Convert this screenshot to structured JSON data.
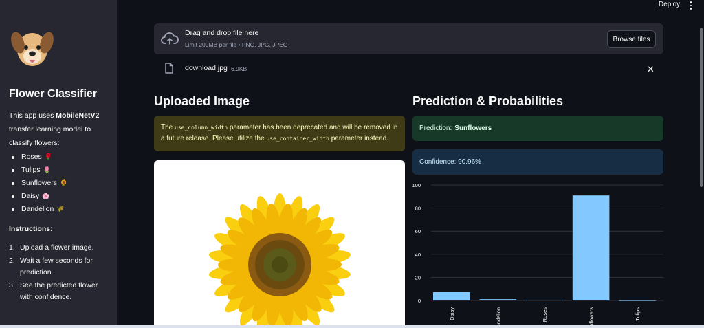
{
  "sidebar": {
    "title": "Flower Classifier",
    "desc_prefix": "This app uses ",
    "desc_model": "MobileNetV2",
    "desc_suffix": " transfer learning model to classify flowers:",
    "flowers": [
      {
        "name": "Roses",
        "emoji": "🌹"
      },
      {
        "name": "Tulips",
        "emoji": "🌷"
      },
      {
        "name": "Sunflowers",
        "emoji": "🌻"
      },
      {
        "name": "Daisy",
        "emoji": "🌸"
      },
      {
        "name": "Dandelion",
        "emoji": "🌾"
      }
    ],
    "instructions_heading": "Instructions:",
    "instructions": [
      "Upload a flower image.",
      "Wait a few seconds for prediction.",
      "See the predicted flower with confidence."
    ]
  },
  "header": {
    "deploy_label": "Deploy"
  },
  "uploader": {
    "title": "Drag and drop file here",
    "subtitle": "Limit 200MB per file • PNG, JPG, JPEG",
    "browse_label": "Browse files",
    "file_name": "download.jpg",
    "file_size": "6.9KB"
  },
  "left": {
    "heading": "Uploaded Image",
    "warning_pre": "The ",
    "warning_code1": "use_column_width",
    "warning_mid": " parameter has been deprecated and will be removed in a future release. Please utilize the ",
    "warning_code2": "use_container_width",
    "warning_post": " parameter instead."
  },
  "right": {
    "heading": "Prediction & Probabilities",
    "prediction_label": "Prediction:",
    "prediction_value": "Sunflowers",
    "confidence_text": "Confidence: 90.96%"
  },
  "colors": {
    "bar": "#83c9ff",
    "grid": "#31333f",
    "axis_text": "#fafafa"
  },
  "chart_data": {
    "type": "bar",
    "categories": [
      "Daisy",
      "Dandelion",
      "Roses",
      "Sunflowers",
      "Tulips"
    ],
    "values": [
      7.2,
      1.1,
      0.6,
      90.96,
      0.1
    ],
    "ylim": [
      0,
      100
    ],
    "yticks": [
      0,
      20,
      40,
      60,
      80,
      100
    ],
    "grid": true
  }
}
